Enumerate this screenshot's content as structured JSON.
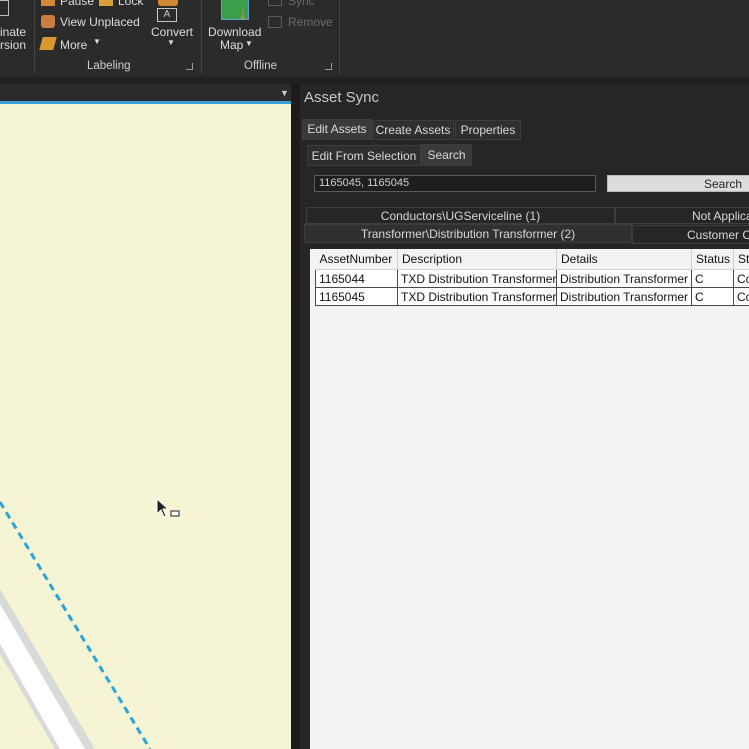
{
  "ribbon": {
    "coord_line1": "inate",
    "coord_line2": "rsion",
    "pause": "Pause",
    "lock": "Lock",
    "view_unplaced": "View Unplaced",
    "more": "More",
    "convert": "Convert",
    "download_line1": "Download",
    "download_line2": "Map",
    "sync": "Sync",
    "remove": "Remove",
    "group_labeling": "Labeling",
    "group_offline": "Offline"
  },
  "pane": {
    "title": "Asset Sync",
    "tabs": [
      "Edit Assets",
      "Create Assets",
      "Properties"
    ],
    "subtabs": [
      "Edit From Selection",
      "Search"
    ],
    "search_value": "1165045, 1165045",
    "search_button": "Search",
    "layer_tabs_row1": [
      "Conductors\\UGServiceline (1)",
      "Not Applicable"
    ],
    "layer_tabs_row2": [
      "Transformer\\Distribution Transformer (2)",
      "Customer Connections"
    ]
  },
  "grid": {
    "columns": [
      "AssetNumber",
      "Description",
      "Details",
      "Status",
      "Status Description"
    ],
    "rows": [
      [
        "1165044",
        "TXD Distribution Transformer",
        "Distribution Transformer",
        "C",
        "Construction"
      ],
      [
        "1165045",
        "TXD Distribution Transformer",
        "Distribution Transformer",
        "C",
        "Construction"
      ]
    ]
  },
  "colors": {
    "accent": "#3b9ed8",
    "map_background": "#f5f5d6",
    "line_feature": "#29a3d9"
  }
}
